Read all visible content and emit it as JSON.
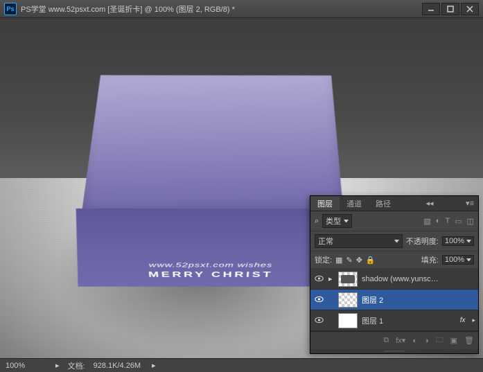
{
  "titlebar": {
    "ps": "Ps",
    "title": "PS学堂 www.52psxt.com [圣诞折卡] @ 100% (图层 2, RGB/8) *"
  },
  "card": {
    "line1": "www.52psxt.com  wishes",
    "line2": "MERRY CHRIST"
  },
  "panel": {
    "tabs": {
      "layers": "图层",
      "channels": "通道",
      "paths": "路径"
    },
    "filter": {
      "search": "⌕",
      "type": "类型"
    },
    "blend": {
      "mode": "正常",
      "opacity_label": "不透明度:",
      "opacity": "100%"
    },
    "lock": {
      "label": "锁定:",
      "fill_label": "填充:",
      "fill": "100%"
    },
    "layers": [
      {
        "name": "shadow (www.yunsc…"
      },
      {
        "name": "图层 2"
      },
      {
        "name": "图层 1"
      }
    ]
  },
  "status": {
    "zoom": "100%",
    "doc_label": "文档:",
    "doc": "928.1K/4.26M"
  }
}
